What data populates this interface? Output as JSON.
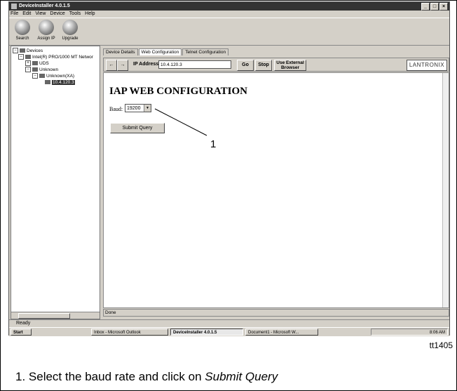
{
  "window": {
    "title": "DeviceInstaller 4.0.1.5"
  },
  "menu": [
    "File",
    "Edit",
    "View",
    "Device",
    "Tools",
    "Help"
  ],
  "toolbar": {
    "search": "Search",
    "assign_ip": "Assign IP",
    "upgrade": "Upgrade"
  },
  "tree": {
    "devices": "Devices",
    "network": "Intel(R) PRO/1000 MT Networ",
    "uds": "UDS",
    "unknown": "Unknown",
    "unknown_xa": "Unknown(XA)",
    "device_ip": "10.4.120.3"
  },
  "tabs": [
    "Device Details",
    "Web Configuration",
    "Telnet Configuration"
  ],
  "browser": {
    "back": "←",
    "forward": "→",
    "ip_label": "IP Address",
    "ip_value": "10.4.120.3",
    "go": "Go",
    "stop": "Stop",
    "external_line1": "Use External",
    "external_line2": "Browser",
    "logo": "LANTRONIX"
  },
  "page": {
    "title": "IAP WEB CONFIGURATION",
    "baud_label": "Baud:",
    "baud_value": "19200",
    "submit": "Submit Query"
  },
  "status": {
    "done": "Done",
    "ready": "Ready"
  },
  "taskbar": {
    "start": "Start",
    "tasks": [
      "Inbox - Microsoft Outlook",
      "DeviceInstaller 4.0.1.5",
      "Document1 - Microsoft W..."
    ],
    "clock": "8:06 AM"
  },
  "annotation": {
    "callout": "1",
    "figure_id": "tt1405",
    "caption_prefix": "1. Select the baud rate and click on ",
    "caption_emph": "Submit Query"
  }
}
